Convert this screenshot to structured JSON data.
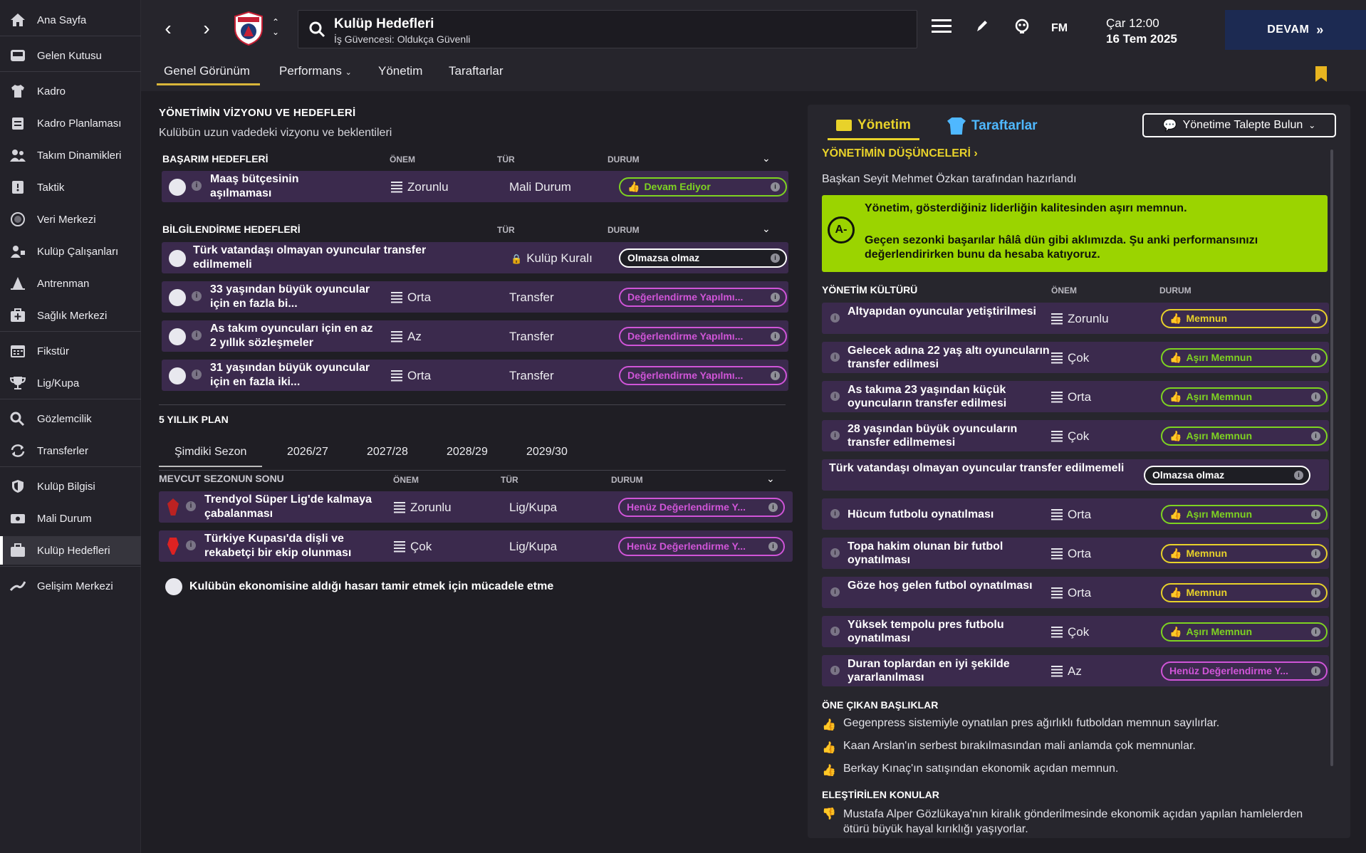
{
  "sidebar": {
    "items": [
      {
        "label": "Ana Sayfa",
        "icon": "home-icon"
      },
      {
        "label": "Gelen Kutusu",
        "icon": "inbox-icon"
      },
      {
        "label": "Kadro",
        "icon": "shirt-icon"
      },
      {
        "label": "Kadro Planlaması",
        "icon": "clipboard-icon"
      },
      {
        "label": "Takım Dinamikleri",
        "icon": "people-icon"
      },
      {
        "label": "Taktik",
        "icon": "tactic-board-icon"
      },
      {
        "label": "Veri Merkezi",
        "icon": "data-circle-icon"
      },
      {
        "label": "Kulüp Çalışanları",
        "icon": "staff-icon"
      },
      {
        "label": "Antrenman",
        "icon": "cone-icon"
      },
      {
        "label": "Sağlık Merkezi",
        "icon": "medical-kit-icon"
      },
      {
        "label": "Fikstür",
        "icon": "calendar-icon"
      },
      {
        "label": "Lig/Kupa",
        "icon": "trophy-icon"
      },
      {
        "label": "Gözlemcilik",
        "icon": "magnifier-icon"
      },
      {
        "label": "Transferler",
        "icon": "transfer-arrows-icon"
      },
      {
        "label": "Kulüp Bilgisi",
        "icon": "shield-icon"
      },
      {
        "label": "Mali Durum",
        "icon": "money-icon"
      },
      {
        "label": "Kulüp Hedefleri",
        "icon": "briefcase-icon"
      },
      {
        "label": "Gelişim Merkezi",
        "icon": "growth-chart-icon"
      }
    ],
    "active": "Kulüp Hedefleri"
  },
  "topbar": {
    "title": "Kulüp Hedefleri",
    "subtitle": "İş Güvencesi: Oldukça Güvenli",
    "fm": "FM",
    "date_line1": "Çar 12:00",
    "date_line2": "16 Tem 2025",
    "continue": "DEVAM"
  },
  "tabs": [
    "Genel Görünüm",
    "Performans",
    "Yönetim",
    "Taraftarlar"
  ],
  "left": {
    "title": "YÖNETİMİN VİZYONU VE HEDEFLERİ",
    "subtitle": "Kulübün uzun vadedeki vizyonu ve beklentileri",
    "basarim": {
      "header": "BAŞARIM HEDEFLERİ",
      "col_onem": "ÖNEM",
      "col_tur": "TÜR",
      "col_durum": "DURUM",
      "rows": [
        {
          "text": "Maaş bütçesinin aşılmaması",
          "onem": "Zorunlu",
          "tur": "Mali Durum",
          "durum": "Devam Ediyor"
        }
      ]
    },
    "bilgi": {
      "header": "BİLGİLENDİRME HEDEFLERİ",
      "col_tur": "TÜR",
      "col_durum": "DURUM",
      "rows": [
        {
          "text": "Türk vatandaşı olmayan oyuncular transfer edilmemeli",
          "onem": "",
          "tur": "Kulüp Kuralı",
          "durum": "Olmazsa olmaz"
        },
        {
          "text": "33 yaşından büyük oyuncular için en fazla bi...",
          "onem": "Orta",
          "tur": "Transfer",
          "durum": "Değerlendirme Yapılmı..."
        },
        {
          "text": "As takım oyuncuları için en az 2 yıllık sözleşmeler",
          "onem": "Az",
          "tur": "Transfer",
          "durum": "Değerlendirme Yapılmı..."
        },
        {
          "text": "31 yaşından büyük oyuncular için en fazla iki...",
          "onem": "Orta",
          "tur": "Transfer",
          "durum": "Değerlendirme Yapılmı..."
        }
      ]
    },
    "plan": {
      "title": "5 YILLIK PLAN",
      "tabs": [
        "Şimdiki Sezon",
        "2026/27",
        "2027/28",
        "2028/29",
        "2029/30"
      ],
      "header": "MEVCUT SEZONUN SONU",
      "col_onem": "ÖNEM",
      "col_tur": "TÜR",
      "col_durum": "DURUM",
      "rows": [
        {
          "text": "Trendyol Süper Lig'de kalmaya çabalanması",
          "onem": "Zorunlu",
          "tur": "Lig/Kupa",
          "durum": "Henüz Değerlendirme Y..."
        },
        {
          "text": "Türkiye Kupası'da dişli ve rekabetçi bir ekip olunması",
          "onem": "Çok",
          "tur": "Lig/Kupa",
          "durum": "Henüz Değerlendirme Y..."
        }
      ]
    },
    "economy": "Kulübün ekonomisine aldığı hasarı tamir etmek için mücadele etme"
  },
  "right": {
    "tab_yonetim": "Yönetim",
    "tab_taraftar": "Taraftarlar",
    "talep": "Yönetime Talepte Bulun",
    "thoughts_title": "YÖNETİMİN DÜŞÜNCELERİ",
    "prepared": "Başkan Seyit Mehmet Özkan tarafından hazırlandı",
    "grade": "A-",
    "summary1": "Yönetim, gösterdiğiniz liderliğin kalitesinden aşırı memnun.",
    "summary2": "Geçen sezonki başarılar hâlâ dün gibi aklımızda. Şu anki performansınızı değerlendirirken bunu da hesaba katıyoruz.",
    "culture": {
      "header": "YÖNETİM KÜLTÜRÜ",
      "col_onem": "ÖNEM",
      "col_durum": "DURUM",
      "rows": [
        {
          "text": "Altyapıdan oyuncular yetiştirilmesi",
          "onem": "Zorunlu",
          "durum": "Memnun"
        },
        {
          "text": "Gelecek adına 22 yaş altı oyuncuların transfer edilmesi",
          "onem": "Çok",
          "durum": "Aşırı Memnun"
        },
        {
          "text": "As takıma 23 yaşından küçük oyuncuların transfer edilmesi",
          "onem": "Orta",
          "durum": "Aşırı Memnun"
        },
        {
          "text": "28 yaşından büyük oyuncuların transfer edilmemesi",
          "onem": "Çok",
          "durum": "Aşırı Memnun"
        },
        {
          "text": "Türk vatandaşı olmayan oyuncular transfer edilmemeli",
          "onem": "",
          "durum": "Olmazsa olmaz"
        },
        {
          "text": "Hücum futbolu oynatılması",
          "onem": "Orta",
          "durum": "Aşırı Memnun"
        },
        {
          "text": "Topa hakim olunan bir futbol oynatılması",
          "onem": "Orta",
          "durum": "Memnun"
        },
        {
          "text": "Göze hoş gelen futbol oynatılması",
          "onem": "Orta",
          "durum": "Memnun"
        },
        {
          "text": "Yüksek tempolu pres futbolu oynatılması",
          "onem": "Çok",
          "durum": "Aşırı Memnun"
        },
        {
          "text": "Duran toplardan en iyi şekilde yararlanılması",
          "onem": "Az",
          "durum": "Henüz Değerlendirme Y..."
        }
      ]
    },
    "highlights": {
      "header": "ÖNE ÇIKAN BAŞLIKLAR",
      "items": [
        "Gegenpress sistemiyle oynatılan pres ağırlıklı futboldan memnun sayılırlar.",
        "Kaan Arslan'ın serbest bırakılmasından mali anlamda çok memnunlar.",
        "Berkay Kınaç'ın satışından ekonomik açıdan memnun."
      ]
    },
    "criticised": {
      "header": "ELEŞTİRİLEN KONULAR",
      "items": [
        "Mustafa Alper Gözlükaya'nın kiralık gönderilmesinde ekonomik açıdan yapılan hamlelerden ötürü büyük hayal kırıklığı yaşıyorlar."
      ]
    }
  },
  "colors": {
    "accent_yellow": "#e8d22a",
    "status_green": "#7ed321",
    "status_purple": "#d055d8",
    "summary_green": "#9bd400",
    "row_purple": "#3b2a4d",
    "continue_blue": "#1c2a52"
  }
}
